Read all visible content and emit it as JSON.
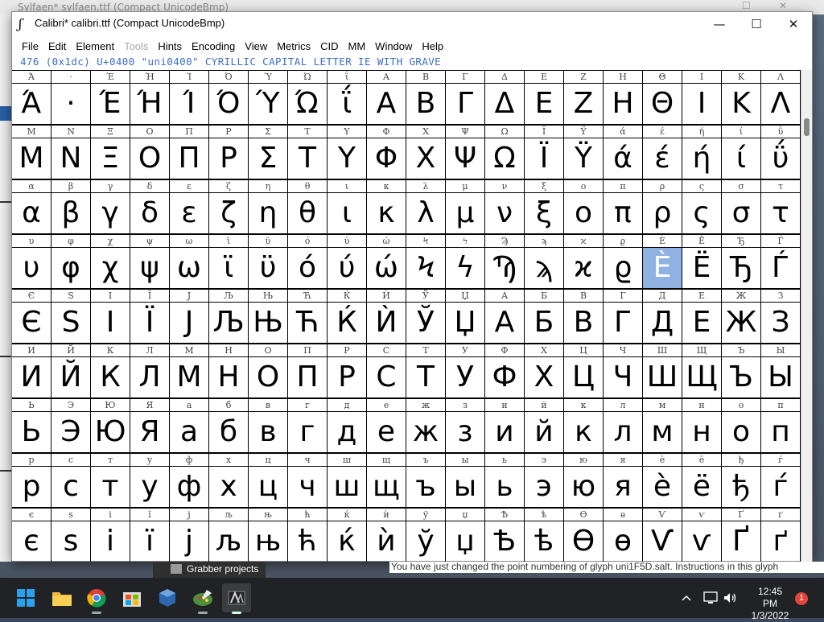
{
  "background_window": {
    "title": "Sylfaen*  sylfaen.ttf (Compact UnicodeBmp)"
  },
  "window": {
    "title": "Calibri*  calibri.ttf (Compact UnicodeBmp)",
    "minimize": "—",
    "maximize": "☐",
    "close": "✕"
  },
  "menu": [
    "File",
    "Edit",
    "Element",
    "Tools",
    "Hints",
    "Encoding",
    "View",
    "Metrics",
    "CID",
    "MM",
    "Window",
    "Help"
  ],
  "menu_disabled": [
    "Tools"
  ],
  "info": "476 (0x1dc) U+0400 \"uni0400\" CYRILLIC CAPITAL LETTER IE WITH GRAVE",
  "selected_glyph": "È",
  "rows": [
    {
      "labels": [
        "Ά",
        "·",
        "Έ",
        "Ή",
        "Ί",
        "Ό",
        "Ύ",
        "Ώ",
        "ΐ",
        "Α",
        "Β",
        "Γ",
        "Δ",
        "Ε",
        "Ζ",
        "Η",
        "Θ",
        "Ι",
        "Κ",
        "Λ"
      ],
      "glyphs": [
        "Ά",
        "·",
        "Έ",
        "Ή",
        "Ί",
        "Ό",
        "Ύ",
        "Ώ",
        "ΐ",
        "Α",
        "Β",
        "Γ",
        "Δ",
        "Ε",
        "Ζ",
        "Η",
        "Θ",
        "Ι",
        "Κ",
        "Λ"
      ]
    },
    {
      "labels": [
        "Μ",
        "Ν",
        "Ξ",
        "Ο",
        "Π",
        "Ρ",
        "Σ",
        "Τ",
        "Υ",
        "Φ",
        "Χ",
        "Ψ",
        "Ω",
        "Ϊ",
        "Ϋ",
        "ά",
        "έ",
        "ή",
        "ί",
        "ΰ"
      ],
      "glyphs": [
        "Μ",
        "Ν",
        "Ξ",
        "Ο",
        "Π",
        "Ρ",
        "Σ",
        "Τ",
        "Υ",
        "Φ",
        "Χ",
        "Ψ",
        "Ω",
        "Ϊ",
        "Ϋ",
        "ά",
        "έ",
        "ή",
        "ί",
        "ΰ"
      ]
    },
    {
      "labels": [
        "α",
        "β",
        "γ",
        "δ",
        "ε",
        "ζ",
        "η",
        "θ",
        "ι",
        "κ",
        "λ",
        "μ",
        "ν",
        "ξ",
        "ο",
        "π",
        "ρ",
        "ς",
        "σ",
        "τ"
      ],
      "glyphs": [
        "α",
        "β",
        "γ",
        "δ",
        "ε",
        "ζ",
        "η",
        "θ",
        "ι",
        "κ",
        "λ",
        "μ",
        "ν",
        "ξ",
        "ο",
        "π",
        "ρ",
        "ς",
        "σ",
        "τ"
      ]
    },
    {
      "labels": [
        "υ",
        "φ",
        "χ",
        "ψ",
        "ω",
        "ϊ",
        "ϋ",
        "ό",
        "ύ",
        "ώ",
        "Ϟ",
        "ϟ",
        "Ϡ",
        "ϡ",
        "ϰ",
        "ϱ",
        "Ѐ",
        "Ё",
        "Ђ",
        "Ѓ"
      ],
      "glyphs": [
        "υ",
        "φ",
        "χ",
        "ψ",
        "ω",
        "ϊ",
        "ϋ",
        "ό",
        "ύ",
        "ώ",
        "Ϟ",
        "ϟ",
        "Ϡ",
        "ϡ",
        "ϰ",
        "ϱ",
        "È",
        "Ë",
        "Ђ",
        "Ѓ"
      ]
    },
    {
      "labels": [
        "Є",
        "Ѕ",
        "І",
        "Ї",
        "Ј",
        "Љ",
        "Њ",
        "Ћ",
        "Ќ",
        "Ѝ",
        "Ў",
        "Џ",
        "А",
        "Б",
        "В",
        "Г",
        "Д",
        "Е",
        "Ж",
        "З"
      ],
      "glyphs": [
        "Є",
        "S",
        "I",
        "Ї",
        "J",
        "Љ",
        "Њ",
        "Ћ",
        "Ќ",
        "Ѝ",
        "Ў",
        "Џ",
        "А",
        "Б",
        "В",
        "Г",
        "Д",
        "Е",
        "Ж",
        "З"
      ]
    },
    {
      "labels": [
        "И",
        "Й",
        "К",
        "Л",
        "М",
        "Н",
        "О",
        "П",
        "Р",
        "С",
        "Т",
        "У",
        "Ф",
        "Х",
        "Ц",
        "Ч",
        "Ш",
        "Щ",
        "Ъ",
        "Ы"
      ],
      "glyphs": [
        "И",
        "Й",
        "К",
        "Л",
        "М",
        "Н",
        "О",
        "П",
        "Р",
        "С",
        "Т",
        "У",
        "Ф",
        "Х",
        "Ц",
        "Ч",
        "Ш",
        "Щ",
        "Ъ",
        "Ы"
      ]
    },
    {
      "labels": [
        "Ь",
        "Э",
        "Ю",
        "Я",
        "а",
        "б",
        "в",
        "г",
        "д",
        "е",
        "ж",
        "з",
        "и",
        "й",
        "к",
        "л",
        "м",
        "н",
        "о",
        "п"
      ],
      "glyphs": [
        "Ь",
        "Э",
        "Ю",
        "Я",
        "а",
        "б",
        "в",
        "г",
        "д",
        "е",
        "ж",
        "з",
        "и",
        "й",
        "к",
        "л",
        "м",
        "н",
        "о",
        "п"
      ]
    },
    {
      "labels": [
        "р",
        "с",
        "т",
        "у",
        "ф",
        "х",
        "ц",
        "ч",
        "ш",
        "щ",
        "ъ",
        "ы",
        "ь",
        "э",
        "ю",
        "я",
        "ѐ",
        "ё",
        "ђ",
        "ѓ"
      ],
      "glyphs": [
        "р",
        "с",
        "т",
        "у",
        "ф",
        "х",
        "ц",
        "ч",
        "ш",
        "щ",
        "ъ",
        "ы",
        "ь",
        "э",
        "ю",
        "я",
        "è",
        "ë",
        "ђ",
        "ѓ"
      ]
    },
    {
      "labels": [
        "є",
        "ѕ",
        "і",
        "ї",
        "ј",
        "љ",
        "њ",
        "ћ",
        "ќ",
        "ѝ",
        "ў",
        "џ",
        "Ѣ",
        "ѣ",
        "Ѳ",
        "ѳ",
        "Ѵ",
        "ѵ",
        "Ґ",
        "ґ"
      ],
      "glyphs": [
        "є",
        "s",
        "i",
        "ї",
        "j",
        "љ",
        "њ",
        "ћ",
        "ќ",
        "ѝ",
        "ў",
        "џ",
        "Ѣ",
        "ѣ",
        "Ѳ",
        "ѳ",
        "Ѵ",
        "ѵ",
        "Ґ",
        "ґ"
      ]
    }
  ],
  "grabber_label": "Grabber projects",
  "message": "You have just changed the point numbering of glyph uni1F5D.salt. Instructions in this glyph",
  "clock": {
    "time": "12:45 PM",
    "date": "1/3/2022"
  },
  "notification_count": "1",
  "taskbar_icons": [
    "windows-start-icon",
    "file-explorer-icon",
    "chrome-icon",
    "store-icon",
    "virtualbox-icon",
    "paint-icon",
    "fontforge-icon"
  ],
  "colors": {
    "selection": "#8fb2e2",
    "info_text": "#3a6fc4",
    "taskbar": "#202226"
  }
}
